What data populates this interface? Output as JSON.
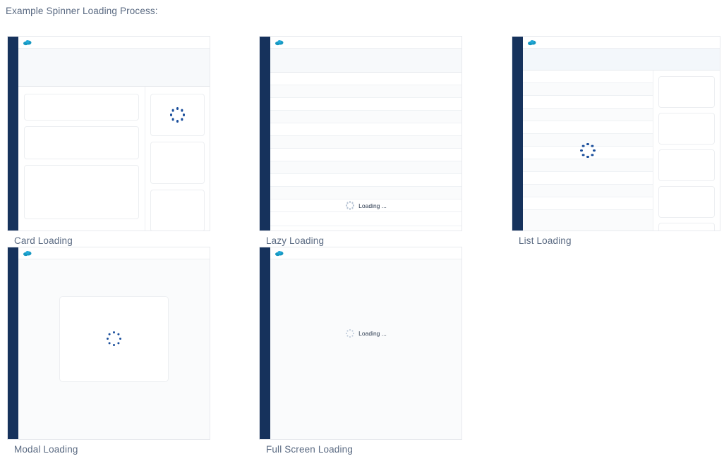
{
  "page": {
    "heading": "Example Spinner Loading Process:",
    "heading_color": "#5a6a82",
    "background": "#ffffff"
  },
  "theme": {
    "rail_navy": "#16325c",
    "logo_blue": "#1798c1",
    "spinner_dot": "#1b4f9c",
    "spinner_dot_muted": "#b9c6d6",
    "panel_border": "#e8eaee",
    "subheader_bg": "#f7f9fb",
    "stage_bg": "#fafbfc",
    "text_color": "#2b3a4f"
  },
  "icons": {
    "app_logo": "cloud-icon",
    "spinner": "spinner-icon"
  },
  "examples": [
    {
      "id": "card-loading",
      "caption": "Card Loading",
      "variant": "card",
      "spinner_label": "",
      "left_cards": 3,
      "right_cards": 3,
      "spinner_in_card_index": 0
    },
    {
      "id": "lazy-loading",
      "caption": "Lazy Loading",
      "variant": "lazy",
      "spinner_label": "Loading ...",
      "rows_before": 11,
      "rows_after": 3
    },
    {
      "id": "list-loading",
      "caption": "List Loading",
      "variant": "list",
      "spinner_label": "",
      "rows": 12,
      "side_cards": 5
    },
    {
      "id": "modal-loading",
      "caption": "Modal Loading",
      "variant": "modal",
      "spinner_label": ""
    },
    {
      "id": "fullscreen-loading",
      "caption": "Full Screen Loading",
      "variant": "fullscreen",
      "spinner_label": "Loading ..."
    }
  ]
}
